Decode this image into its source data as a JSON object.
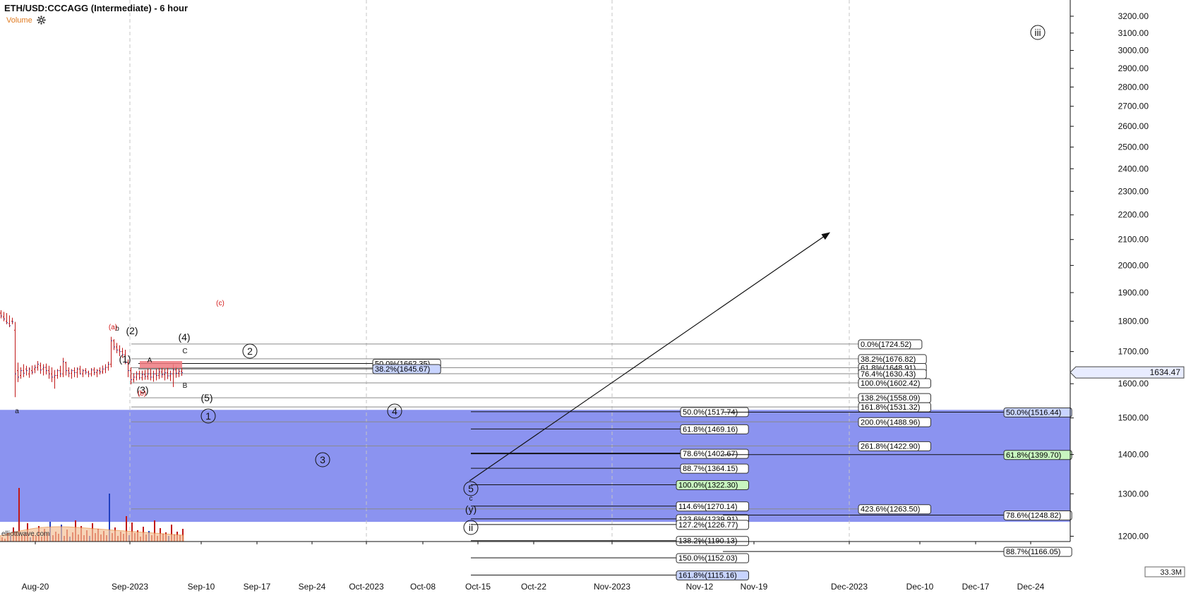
{
  "title": "ETH/USD:CCCAGG (Intermediate) - 6 hour",
  "volume_label": "Volume",
  "icons": {
    "settings": "gear-icon"
  },
  "colors": {
    "zone": "#8b93f0",
    "accent_red": "#d31a1a",
    "volume_red": "#c01818",
    "volume_blue": "#2040c0",
    "volume_ma": "#f5c29a",
    "highlight_green": "#c8f5c0",
    "highlight_blue": "#c8d4ff",
    "vol_label": "#e07a1f"
  },
  "chart_data": {
    "type": "bar",
    "price_axis": {
      "ticks": [
        "3200.00",
        "3100.00",
        "3000.00",
        "2900.00",
        "2800.00",
        "2700.00",
        "2600.00",
        "2500.00",
        "2400.00",
        "2300.00",
        "2200.00",
        "2100.00",
        "2000.00",
        "1900.00",
        "1800.00",
        "1700.00",
        "1600.00",
        "1500.00",
        "1400.00",
        "1300.00",
        "1200.00"
      ],
      "scale": "log",
      "current_price": "1634.47",
      "volume_max": "33.3M"
    },
    "time_axis": {
      "ticks": [
        "Aug-20",
        "Sep-2023",
        "Sep-10",
        "Sep-17",
        "Sep-24",
        "Oct-2023",
        "Oct-08",
        "Oct-15",
        "Oct-22",
        "Nov-2023",
        "Nov-12",
        "Nov-19",
        "Dec-2023",
        "Dec-10",
        "Dec-17",
        "Dec-24"
      ],
      "major": [
        "Sep-2023",
        "Oct-2023",
        "Nov-2023",
        "Dec-2023"
      ]
    },
    "support_zone": {
      "low": 1233,
      "high": 1523
    },
    "fib_set_a": [
      "0.0%(1724.52)",
      "38.2%(1676.82)",
      "61.8%(1648.91)",
      "76.4%(1630.43)",
      "100.0%(1602.42)",
      "138.2%(1558.09)",
      "161.8%(1531.32)",
      "200.0%(1488.96)",
      "261.8%(1422.90)",
      "423.6%(1263.50)"
    ],
    "fib_set_b": [
      "50.0%(1662.35)",
      "38.2%(1645.67)"
    ],
    "fib_set_c": [
      "50.0%(1517.74)",
      "61.8%(1469.16)",
      "78.6%(1402.67)",
      "88.7%(1364.15)",
      "100.0%(1322.30)",
      "114.6%(1270.14)",
      "123.6%(1239.91)",
      "127.2%(1226.77)",
      "138.2%(1190.13)",
      "150.0%(1152.03)",
      "161.8%(1115.16)"
    ],
    "fib_set_d": [
      "50.0%(1516.44)",
      "61.8%(1399.70)",
      "78.6%(1248.82)",
      "88.7%(1166.05)"
    ],
    "wave_labels": {
      "black": [
        "(2)",
        "(1)",
        "(3)",
        "(4)",
        "(5)",
        "a",
        "b",
        "A",
        "B",
        "C",
        "c",
        "(y)"
      ],
      "circled": [
        "1",
        "2",
        "3",
        "4",
        "5",
        "ii",
        "iii"
      ],
      "red": [
        "(a)",
        "(c)",
        "(b)"
      ]
    },
    "watermark": "elliottwave.com"
  }
}
